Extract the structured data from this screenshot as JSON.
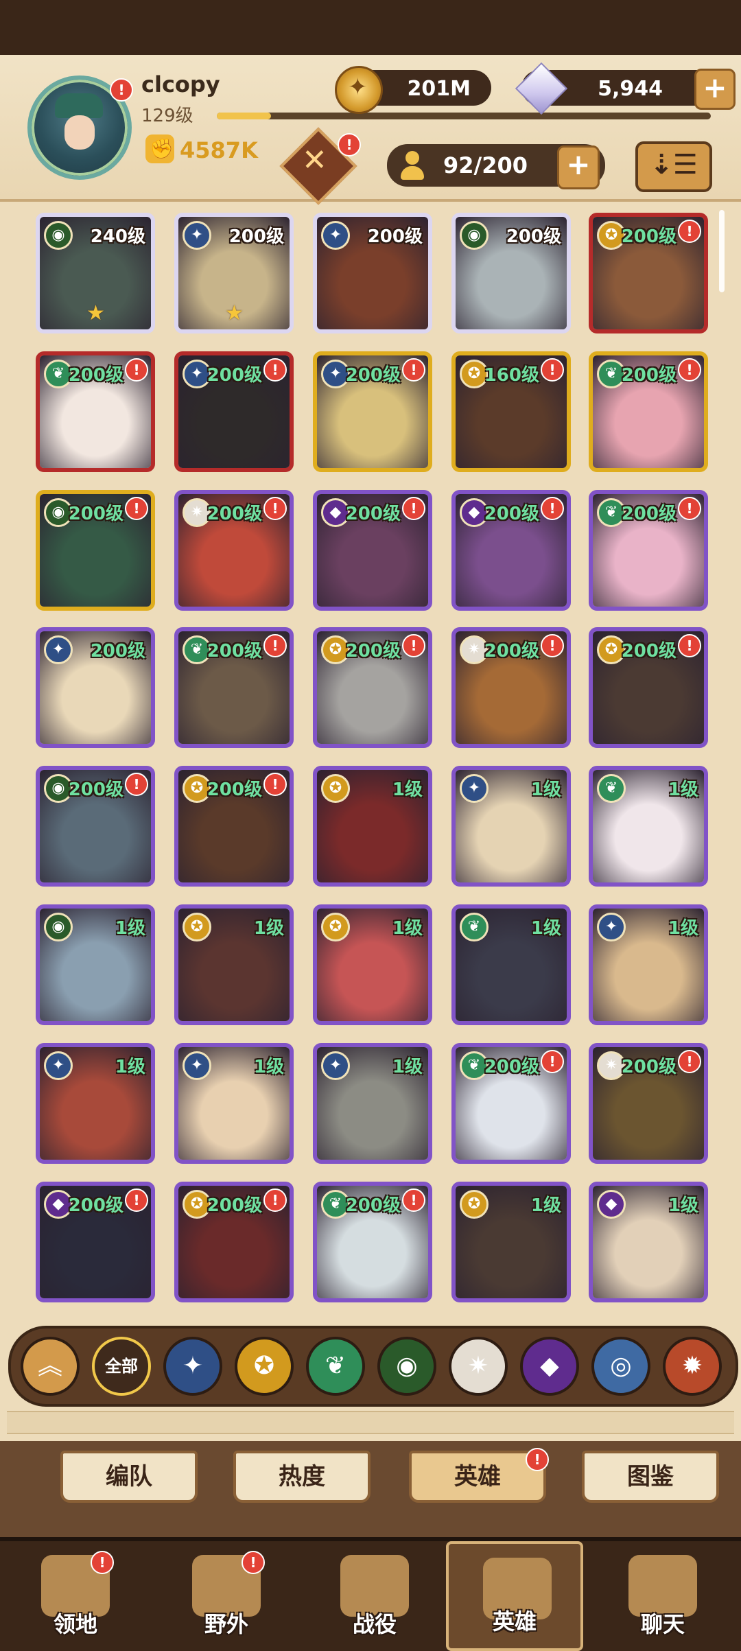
{
  "player": {
    "name": "clcopy",
    "level": "129级",
    "power": "4587K",
    "xp_progress": 0.11
  },
  "currency": {
    "gold": "201M",
    "diamonds": "5,944"
  },
  "hero_capacity": "92/200",
  "sort_icon": "sort-icon",
  "heroes": [
    {
      "level": "240级",
      "faction": "graveborn",
      "border": "white",
      "star": true,
      "badge": false
    },
    {
      "level": "200级",
      "faction": "lightbearer",
      "border": "white",
      "star": true,
      "badge": false
    },
    {
      "level": "200级",
      "faction": "lightbearer",
      "border": "white",
      "star": false,
      "badge": false
    },
    {
      "level": "200级",
      "faction": "graveborn",
      "border": "white",
      "star": false,
      "badge": false
    },
    {
      "level": "200级",
      "faction": "mauler",
      "border": "red",
      "star": false,
      "badge": true
    },
    {
      "level": "200级",
      "faction": "wilder",
      "border": "red",
      "star": false,
      "badge": true
    },
    {
      "level": "200级",
      "faction": "lightbearer",
      "border": "red",
      "star": false,
      "badge": true
    },
    {
      "level": "200级",
      "faction": "lightbearer",
      "border": "gold",
      "star": false,
      "badge": true
    },
    {
      "level": "160级",
      "faction": "mauler",
      "border": "gold",
      "star": false,
      "badge": true
    },
    {
      "level": "200级",
      "faction": "wilder",
      "border": "gold",
      "star": false,
      "badge": true
    },
    {
      "level": "200级",
      "faction": "graveborn",
      "border": "gold",
      "star": false,
      "badge": true
    },
    {
      "level": "200级",
      "faction": "celestial",
      "border": "purple",
      "star": false,
      "badge": true
    },
    {
      "level": "200级",
      "faction": "hypogean",
      "border": "purple",
      "star": false,
      "badge": true
    },
    {
      "level": "200级",
      "faction": "hypogean",
      "border": "purple",
      "star": false,
      "badge": true
    },
    {
      "level": "200级",
      "faction": "wilder",
      "border": "purple",
      "star": false,
      "badge": true
    },
    {
      "level": "200级",
      "faction": "lightbearer",
      "border": "purple",
      "star": false,
      "badge": false
    },
    {
      "level": "200级",
      "faction": "wilder",
      "border": "purple",
      "star": false,
      "badge": true
    },
    {
      "level": "200级",
      "faction": "mauler",
      "border": "purple",
      "star": false,
      "badge": true
    },
    {
      "level": "200级",
      "faction": "celestial",
      "border": "purple",
      "star": false,
      "badge": true
    },
    {
      "level": "200级",
      "faction": "mauler",
      "border": "purple",
      "star": false,
      "badge": true
    },
    {
      "level": "200级",
      "faction": "graveborn",
      "border": "purple",
      "star": false,
      "badge": true
    },
    {
      "level": "200级",
      "faction": "mauler",
      "border": "purple",
      "star": false,
      "badge": true
    },
    {
      "level": "1级",
      "faction": "mauler",
      "border": "purple",
      "star": false,
      "badge": false
    },
    {
      "level": "1级",
      "faction": "lightbearer",
      "border": "purple",
      "star": false,
      "badge": false
    },
    {
      "level": "1级",
      "faction": "wilder",
      "border": "purple",
      "star": false,
      "badge": false
    },
    {
      "level": "1级",
      "faction": "graveborn",
      "border": "purple",
      "star": false,
      "badge": false
    },
    {
      "level": "1级",
      "faction": "mauler",
      "border": "purple",
      "star": false,
      "badge": false
    },
    {
      "level": "1级",
      "faction": "mauler",
      "border": "purple",
      "star": false,
      "badge": false
    },
    {
      "level": "1级",
      "faction": "wilder",
      "border": "purple",
      "star": false,
      "badge": false
    },
    {
      "level": "1级",
      "faction": "lightbearer",
      "border": "purple",
      "star": false,
      "badge": false
    },
    {
      "level": "1级",
      "faction": "lightbearer",
      "border": "purple",
      "star": false,
      "badge": false
    },
    {
      "level": "1级",
      "faction": "lightbearer",
      "border": "purple",
      "star": false,
      "badge": false
    },
    {
      "level": "1级",
      "faction": "lightbearer",
      "border": "purple",
      "star": false,
      "badge": false
    },
    {
      "level": "200级",
      "faction": "wilder",
      "border": "purple",
      "star": false,
      "badge": true
    },
    {
      "level": "200级",
      "faction": "celestial",
      "border": "purple",
      "star": false,
      "badge": true
    },
    {
      "level": "200级",
      "faction": "hypogean",
      "border": "purple",
      "star": false,
      "badge": true
    },
    {
      "level": "200级",
      "faction": "mauler",
      "border": "purple",
      "star": false,
      "badge": true
    },
    {
      "level": "200级",
      "faction": "wilder",
      "border": "purple",
      "star": false,
      "badge": true
    },
    {
      "level": "1级",
      "faction": "mauler",
      "border": "purple",
      "star": false,
      "badge": false
    },
    {
      "level": "1级",
      "faction": "hypogean",
      "border": "purple",
      "star": false,
      "badge": false
    }
  ],
  "filters": [
    {
      "name": "collapse",
      "icon": "chevron-up-icon",
      "label": ""
    },
    {
      "name": "all",
      "icon": "",
      "label": "全部"
    },
    {
      "name": "lightbearer",
      "icon": "lightbearer-icon",
      "label": ""
    },
    {
      "name": "mauler",
      "icon": "mauler-icon",
      "label": ""
    },
    {
      "name": "wilder",
      "icon": "wilder-icon",
      "label": ""
    },
    {
      "name": "graveborn",
      "icon": "graveborn-icon",
      "label": ""
    },
    {
      "name": "celestial",
      "icon": "celestial-icon",
      "label": ""
    },
    {
      "name": "hypogean",
      "icon": "hypogean-icon",
      "label": ""
    },
    {
      "name": "dimensional",
      "icon": "dimensional-icon",
      "label": ""
    },
    {
      "name": "fire",
      "icon": "fire-icon",
      "label": ""
    }
  ],
  "subtabs": [
    {
      "label": "编队",
      "active": false,
      "badge": false
    },
    {
      "label": "热度",
      "active": false,
      "badge": false
    },
    {
      "label": "英雄",
      "active": true,
      "badge": true
    },
    {
      "label": "图鉴",
      "active": false,
      "badge": false
    }
  ],
  "bottom_nav": [
    {
      "label": "领地",
      "icon": "castle-icon",
      "active": false,
      "badge": true
    },
    {
      "label": "野外",
      "icon": "scroll-map-icon",
      "active": false,
      "badge": true
    },
    {
      "label": "战役",
      "icon": "sword-icon",
      "active": false,
      "badge": false
    },
    {
      "label": "英雄",
      "icon": "knight-icon",
      "active": true,
      "badge": false
    },
    {
      "label": "聊天",
      "icon": "chat-icon",
      "active": false,
      "badge": false
    }
  ],
  "badge_symbol": "!",
  "faction_colors": {
    "lightbearer": "#2f4f86",
    "mauler": "#d29a1e",
    "wilder": "#2f8e59",
    "graveborn": "#2a5a2a",
    "celestial": "#e4ddd2",
    "hypogean": "#5f2c8e",
    "dimensional": "#3f6aa3",
    "fire": "#b84a2a"
  },
  "faction_glyphs": {
    "lightbearer": "✦",
    "mauler": "✪",
    "wilder": "❦",
    "graveborn": "◉",
    "celestial": "✷",
    "hypogean": "◆",
    "dimensional": "◎",
    "fire": "✹"
  },
  "art_colors": [
    "#4a5a52",
    "#c7b48a",
    "#7a3f2b",
    "#aab3b6",
    "#8b5a3a",
    "#f2e7e0",
    "#2e2a2a",
    "#d8c07c",
    "#5b3b2a",
    "#e7a4b0",
    "#355a46",
    "#c04a3a",
    "#6a4060",
    "#7b4f8d",
    "#e9b3c8",
    "#e9d8b8",
    "#6c5a48",
    "#a5a3a0",
    "#a56a36",
    "#4b3a33",
    "#5a6b78",
    "#5a3a2a",
    "#7b2a2a",
    "#e5d3b3",
    "#f0e6ea",
    "#8a9fb0",
    "#5b3530",
    "#c65555",
    "#3b3b4a",
    "#d9b98d",
    "#a84a3a",
    "#e8d0b0",
    "#8c8c84",
    "#dfe3ea",
    "#6b5530",
    "#2a2a3a",
    "#6a2a2a",
    "#d5dde0",
    "#4a3a33",
    "#e2d0b8"
  ]
}
